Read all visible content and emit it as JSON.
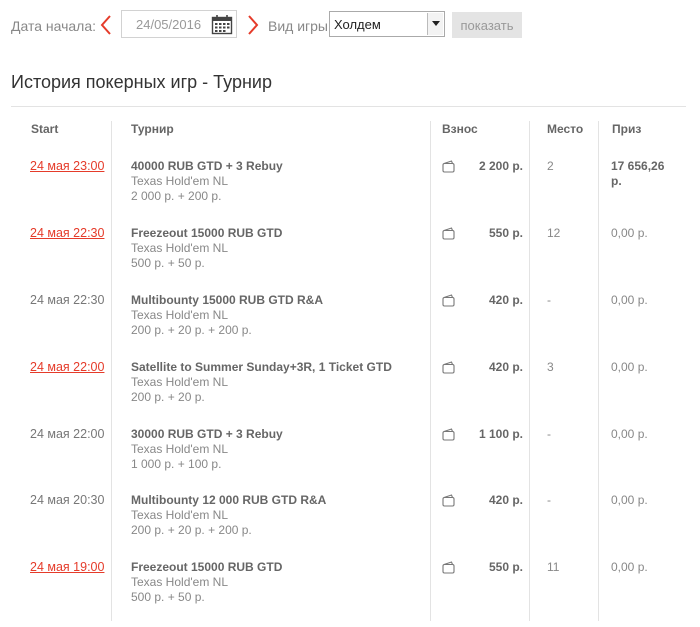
{
  "filters": {
    "date_label": "Дата начала:",
    "date_value": "24/05/2016",
    "game_label": "Вид игры:",
    "game_value": "Холдем",
    "show_label": "показать",
    "colors": {
      "arrow": "#e53b2a",
      "button_bg": "#e4e4e4"
    },
    "icons": {
      "prev": "chevron-left-icon",
      "next": "chevron-right-icon",
      "calendar": "calendar-icon"
    }
  },
  "page": {
    "title": "История покерных игр - Турнир"
  },
  "table": {
    "headers": {
      "start": "Start",
      "tournament": "Турнир",
      "fee": "Взнос",
      "place": "Место",
      "prize": "Приз"
    },
    "rows": [
      {
        "start": "24 мая 23:00",
        "link": true,
        "name": "40000 RUB GTD + 3 Rebuy",
        "game": "Texas Hold'em NL",
        "buyin": "2 000 р. + 200 р.",
        "fee": "2 200 р.",
        "place": "2",
        "prize": "17 656,26",
        "prize_unit": "р.",
        "prize_bold": true
      },
      {
        "start": "24 мая 22:30",
        "link": true,
        "name": "Freezeout 15000 RUB GTD",
        "game": "Texas Hold'em NL",
        "buyin": "500 р. + 50 р.",
        "fee": "550 р.",
        "place": "12",
        "prize": "0,00 р.",
        "prize_unit": "",
        "prize_bold": false
      },
      {
        "start": "24 мая 22:30",
        "link": false,
        "name": "Multibounty 15000 RUB GTD R&A",
        "game": "Texas Hold'em NL",
        "buyin": "200 р. + 20 р. + 200 р.",
        "fee": "420 р.",
        "place": "-",
        "prize": "0,00 р.",
        "prize_unit": "",
        "prize_bold": false
      },
      {
        "start": "24 мая 22:00",
        "link": true,
        "name": "Satellite to Summer Sunday+3R, 1 Ticket GTD",
        "game": "Texas Hold'em NL",
        "buyin": "200 р. + 20 р.",
        "fee": "420 р.",
        "place": "3",
        "prize": "0,00 р.",
        "prize_unit": "",
        "prize_bold": false
      },
      {
        "start": "24 мая 22:00",
        "link": false,
        "name": "30000 RUB GTD + 3 Rebuy",
        "game": "Texas Hold'em NL",
        "buyin": "1 000 р. + 100 р.",
        "fee": "1 100 р.",
        "place": "-",
        "prize": "0,00 р.",
        "prize_unit": "",
        "prize_bold": false
      },
      {
        "start": "24 мая 20:30",
        "link": false,
        "name": "Multibounty 12 000 RUB GTD R&A",
        "game": "Texas Hold'em NL",
        "buyin": "200 р. + 20 р. + 200 р.",
        "fee": "420 р.",
        "place": "-",
        "prize": "0,00 р.",
        "prize_unit": "",
        "prize_bold": false
      },
      {
        "start": "24 мая 19:00",
        "link": true,
        "name": "Freezeout 15000 RUB GTD",
        "game": "Texas Hold'em NL",
        "buyin": "500 р. + 50 р.",
        "fee": "550 р.",
        "place": "11",
        "prize": "0,00 р.",
        "prize_unit": "",
        "prize_bold": false
      }
    ]
  }
}
